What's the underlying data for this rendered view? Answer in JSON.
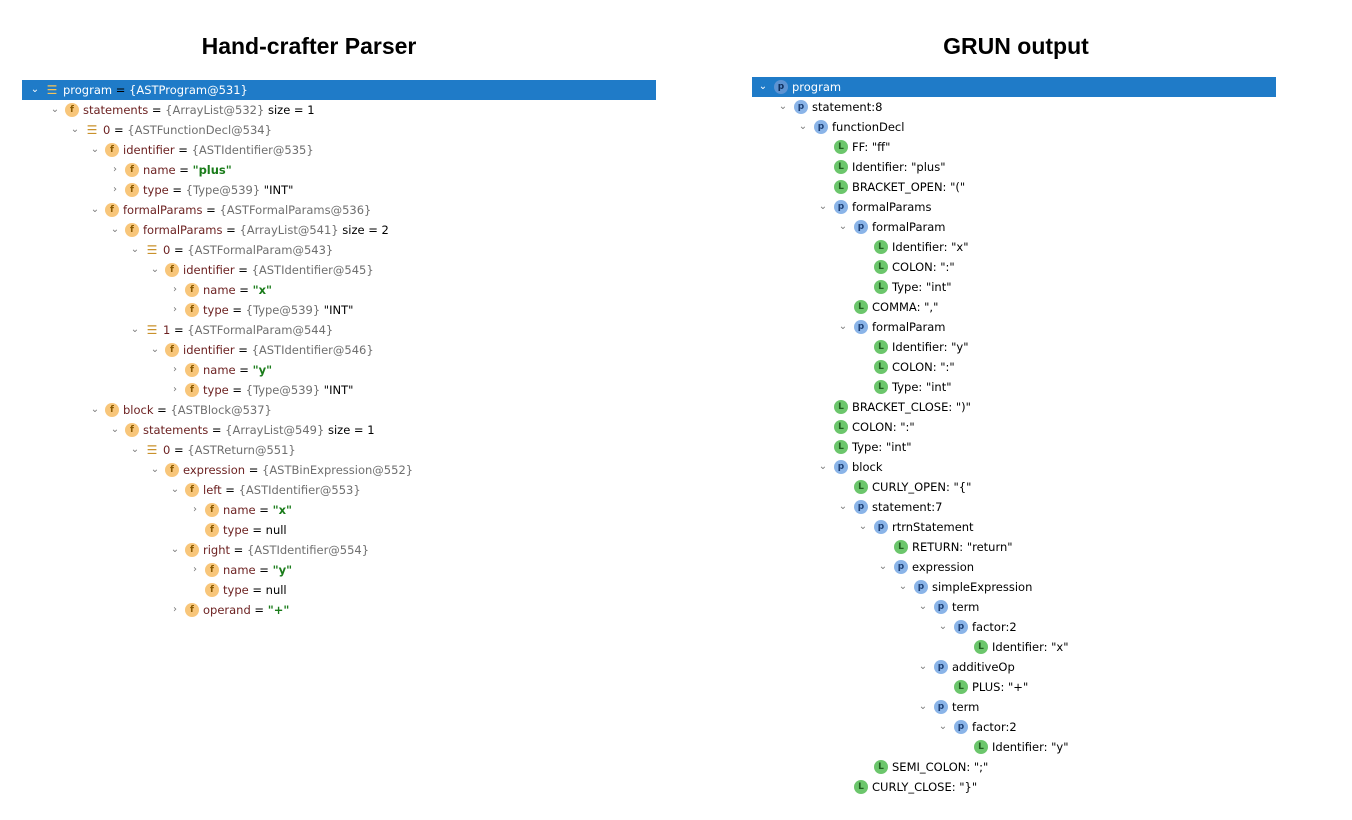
{
  "left_panel": {
    "title": "Hand-crafter Parser",
    "nodes": [
      {
        "depth": 0,
        "exp": "open",
        "icon": "arr",
        "icon_name": "array-icon",
        "name": "program",
        "eq": " = ",
        "type": "{ASTProgram@531}",
        "extra": "",
        "str": "",
        "sel": true
      },
      {
        "depth": 1,
        "exp": "open",
        "icon": "f",
        "icon_name": "field-icon",
        "name": "statements",
        "eq": " = ",
        "type": "{ArrayList@532}",
        "extra": "  size = 1",
        "str": ""
      },
      {
        "depth": 2,
        "exp": "open",
        "icon": "arr",
        "icon_name": "array-icon",
        "name": "0",
        "eq": " = ",
        "type": "{ASTFunctionDecl@534}",
        "extra": "",
        "str": ""
      },
      {
        "depth": 3,
        "exp": "open",
        "icon": "f",
        "icon_name": "field-icon",
        "name": "identifier",
        "eq": " = ",
        "type": "{ASTIdentifier@535}",
        "extra": "",
        "str": ""
      },
      {
        "depth": 4,
        "exp": "closed",
        "icon": "f",
        "icon_name": "field-icon",
        "name": "name",
        "eq": " = ",
        "type": "",
        "extra": "",
        "str": "\"plus\""
      },
      {
        "depth": 4,
        "exp": "closed",
        "icon": "f",
        "icon_name": "field-icon",
        "name": "type",
        "eq": " = ",
        "type": "{Type@539}",
        "extra": " \"INT\"",
        "str": ""
      },
      {
        "depth": 3,
        "exp": "open",
        "icon": "f",
        "icon_name": "field-icon",
        "name": "formalParams",
        "eq": " = ",
        "type": "{ASTFormalParams@536}",
        "extra": "",
        "str": ""
      },
      {
        "depth": 4,
        "exp": "open",
        "icon": "f",
        "icon_name": "field-icon",
        "name": "formalParams",
        "eq": " = ",
        "type": "{ArrayList@541}",
        "extra": "  size = 2",
        "str": ""
      },
      {
        "depth": 5,
        "exp": "open",
        "icon": "arr",
        "icon_name": "array-icon",
        "name": "0",
        "eq": " = ",
        "type": "{ASTFormalParam@543}",
        "extra": "",
        "str": ""
      },
      {
        "depth": 6,
        "exp": "open",
        "icon": "f",
        "icon_name": "field-icon",
        "name": "identifier",
        "eq": " = ",
        "type": "{ASTIdentifier@545}",
        "extra": "",
        "str": ""
      },
      {
        "depth": 7,
        "exp": "closed",
        "icon": "f",
        "icon_name": "field-icon",
        "name": "name",
        "eq": " = ",
        "type": "",
        "extra": "",
        "str": "\"x\""
      },
      {
        "depth": 7,
        "exp": "closed",
        "icon": "f",
        "icon_name": "field-icon",
        "name": "type",
        "eq": " = ",
        "type": "{Type@539}",
        "extra": " \"INT\"",
        "str": ""
      },
      {
        "depth": 5,
        "exp": "open",
        "icon": "arr",
        "icon_name": "array-icon",
        "name": "1",
        "eq": " = ",
        "type": "{ASTFormalParam@544}",
        "extra": "",
        "str": ""
      },
      {
        "depth": 6,
        "exp": "open",
        "icon": "f",
        "icon_name": "field-icon",
        "name": "identifier",
        "eq": " = ",
        "type": "{ASTIdentifier@546}",
        "extra": "",
        "str": ""
      },
      {
        "depth": 7,
        "exp": "closed",
        "icon": "f",
        "icon_name": "field-icon",
        "name": "name",
        "eq": " = ",
        "type": "",
        "extra": "",
        "str": "\"y\""
      },
      {
        "depth": 7,
        "exp": "closed",
        "icon": "f",
        "icon_name": "field-icon",
        "name": "type",
        "eq": " = ",
        "type": "{Type@539}",
        "extra": " \"INT\"",
        "str": ""
      },
      {
        "depth": 3,
        "exp": "open",
        "icon": "f",
        "icon_name": "field-icon",
        "name": "block",
        "eq": " = ",
        "type": "{ASTBlock@537}",
        "extra": "",
        "str": ""
      },
      {
        "depth": 4,
        "exp": "open",
        "icon": "f",
        "icon_name": "field-icon",
        "name": "statements",
        "eq": " = ",
        "type": "{ArrayList@549}",
        "extra": "  size = 1",
        "str": ""
      },
      {
        "depth": 5,
        "exp": "open",
        "icon": "arr",
        "icon_name": "array-icon",
        "name": "0",
        "eq": " = ",
        "type": "{ASTReturn@551}",
        "extra": "",
        "str": ""
      },
      {
        "depth": 6,
        "exp": "open",
        "icon": "f",
        "icon_name": "field-icon",
        "name": "expression",
        "eq": " = ",
        "type": "{ASTBinExpression@552}",
        "extra": "",
        "str": ""
      },
      {
        "depth": 7,
        "exp": "open",
        "icon": "f",
        "icon_name": "field-icon",
        "name": "left",
        "eq": " = ",
        "type": "{ASTIdentifier@553}",
        "extra": "",
        "str": ""
      },
      {
        "depth": 8,
        "exp": "closed",
        "icon": "f",
        "icon_name": "field-icon",
        "name": "name",
        "eq": " = ",
        "type": "",
        "extra": "",
        "str": "\"x\""
      },
      {
        "depth": 8,
        "exp": "none",
        "icon": "f",
        "icon_name": "field-icon",
        "name": "type",
        "eq": " = ",
        "type": "",
        "extra": "null",
        "str": ""
      },
      {
        "depth": 7,
        "exp": "open",
        "icon": "f",
        "icon_name": "field-icon",
        "name": "right",
        "eq": " = ",
        "type": "{ASTIdentifier@554}",
        "extra": "",
        "str": ""
      },
      {
        "depth": 8,
        "exp": "closed",
        "icon": "f",
        "icon_name": "field-icon",
        "name": "name",
        "eq": " = ",
        "type": "",
        "extra": "",
        "str": "\"y\""
      },
      {
        "depth": 8,
        "exp": "none",
        "icon": "f",
        "icon_name": "field-icon",
        "name": "type",
        "eq": " = ",
        "type": "",
        "extra": "null",
        "str": ""
      },
      {
        "depth": 7,
        "exp": "closed",
        "icon": "f",
        "icon_name": "field-icon",
        "name": "operand",
        "eq": " = ",
        "type": "",
        "extra": "",
        "str": "\"+\""
      }
    ]
  },
  "right_panel": {
    "title": "GRUN output",
    "nodes": [
      {
        "depth": 0,
        "exp": "open",
        "icon": "p",
        "icon_name": "parser-rule-icon",
        "text": "program",
        "sel": true
      },
      {
        "depth": 1,
        "exp": "open",
        "icon": "p",
        "icon_name": "parser-rule-icon",
        "text": "statement:8"
      },
      {
        "depth": 2,
        "exp": "open",
        "icon": "p",
        "icon_name": "parser-rule-icon",
        "text": "functionDecl"
      },
      {
        "depth": 3,
        "exp": "none",
        "icon": "l",
        "icon_name": "lexer-token-icon",
        "text": "FF: \"ff\""
      },
      {
        "depth": 3,
        "exp": "none",
        "icon": "l",
        "icon_name": "lexer-token-icon",
        "text": "Identifier: \"plus\""
      },
      {
        "depth": 3,
        "exp": "none",
        "icon": "l",
        "icon_name": "lexer-token-icon",
        "text": "BRACKET_OPEN: \"(\""
      },
      {
        "depth": 3,
        "exp": "open",
        "icon": "p",
        "icon_name": "parser-rule-icon",
        "text": "formalParams"
      },
      {
        "depth": 4,
        "exp": "open",
        "icon": "p",
        "icon_name": "parser-rule-icon",
        "text": "formalParam"
      },
      {
        "depth": 5,
        "exp": "none",
        "icon": "l",
        "icon_name": "lexer-token-icon",
        "text": "Identifier: \"x\""
      },
      {
        "depth": 5,
        "exp": "none",
        "icon": "l",
        "icon_name": "lexer-token-icon",
        "text": "COLON: \":\""
      },
      {
        "depth": 5,
        "exp": "none",
        "icon": "l",
        "icon_name": "lexer-token-icon",
        "text": "Type: \"int\""
      },
      {
        "depth": 4,
        "exp": "none",
        "icon": "l",
        "icon_name": "lexer-token-icon",
        "text": "COMMA: \",\""
      },
      {
        "depth": 4,
        "exp": "open",
        "icon": "p",
        "icon_name": "parser-rule-icon",
        "text": "formalParam"
      },
      {
        "depth": 5,
        "exp": "none",
        "icon": "l",
        "icon_name": "lexer-token-icon",
        "text": "Identifier: \"y\""
      },
      {
        "depth": 5,
        "exp": "none",
        "icon": "l",
        "icon_name": "lexer-token-icon",
        "text": "COLON: \":\""
      },
      {
        "depth": 5,
        "exp": "none",
        "icon": "l",
        "icon_name": "lexer-token-icon",
        "text": "Type: \"int\""
      },
      {
        "depth": 3,
        "exp": "none",
        "icon": "l",
        "icon_name": "lexer-token-icon",
        "text": "BRACKET_CLOSE: \")\""
      },
      {
        "depth": 3,
        "exp": "none",
        "icon": "l",
        "icon_name": "lexer-token-icon",
        "text": "COLON: \":\""
      },
      {
        "depth": 3,
        "exp": "none",
        "icon": "l",
        "icon_name": "lexer-token-icon",
        "text": "Type: \"int\""
      },
      {
        "depth": 3,
        "exp": "open",
        "icon": "p",
        "icon_name": "parser-rule-icon",
        "text": "block"
      },
      {
        "depth": 4,
        "exp": "none",
        "icon": "l",
        "icon_name": "lexer-token-icon",
        "text": "CURLY_OPEN: \"{\""
      },
      {
        "depth": 4,
        "exp": "open",
        "icon": "p",
        "icon_name": "parser-rule-icon",
        "text": "statement:7"
      },
      {
        "depth": 5,
        "exp": "open",
        "icon": "p",
        "icon_name": "parser-rule-icon",
        "text": "rtrnStatement"
      },
      {
        "depth": 6,
        "exp": "none",
        "icon": "l",
        "icon_name": "lexer-token-icon",
        "text": "RETURN: \"return\""
      },
      {
        "depth": 6,
        "exp": "open",
        "icon": "p",
        "icon_name": "parser-rule-icon",
        "text": "expression"
      },
      {
        "depth": 7,
        "exp": "open",
        "icon": "p",
        "icon_name": "parser-rule-icon",
        "text": "simpleExpression"
      },
      {
        "depth": 8,
        "exp": "open",
        "icon": "p",
        "icon_name": "parser-rule-icon",
        "text": "term"
      },
      {
        "depth": 9,
        "exp": "open",
        "icon": "p",
        "icon_name": "parser-rule-icon",
        "text": "factor:2"
      },
      {
        "depth": 10,
        "exp": "none",
        "icon": "l",
        "icon_name": "lexer-token-icon",
        "text": "Identifier: \"x\""
      },
      {
        "depth": 8,
        "exp": "open",
        "icon": "p",
        "icon_name": "parser-rule-icon",
        "text": "additiveOp"
      },
      {
        "depth": 9,
        "exp": "none",
        "icon": "l",
        "icon_name": "lexer-token-icon",
        "text": "PLUS: \"+\""
      },
      {
        "depth": 8,
        "exp": "open",
        "icon": "p",
        "icon_name": "parser-rule-icon",
        "text": "term"
      },
      {
        "depth": 9,
        "exp": "open",
        "icon": "p",
        "icon_name": "parser-rule-icon",
        "text": "factor:2"
      },
      {
        "depth": 10,
        "exp": "none",
        "icon": "l",
        "icon_name": "lexer-token-icon",
        "text": "Identifier: \"y\""
      },
      {
        "depth": 5,
        "exp": "none",
        "icon": "l",
        "icon_name": "lexer-token-icon",
        "text": "SEMI_COLON: \";\""
      },
      {
        "depth": 4,
        "exp": "none",
        "icon": "l",
        "icon_name": "lexer-token-icon",
        "text": "CURLY_CLOSE: \"}\""
      }
    ]
  },
  "icons": {
    "field": "f",
    "parser_rule": "p",
    "lexer_token": "L",
    "array": "☰",
    "expanded": "⌄",
    "collapsed": "›"
  },
  "colors": {
    "selection": "#1f7bc8",
    "field_icon": "#f8c67a",
    "parser_icon": "#8ab4e8",
    "lexer_icon": "#6cc66c",
    "string_value": "#1a7c1a",
    "field_name": "#6b1f1f",
    "type_ref": "#6f6f6f"
  }
}
